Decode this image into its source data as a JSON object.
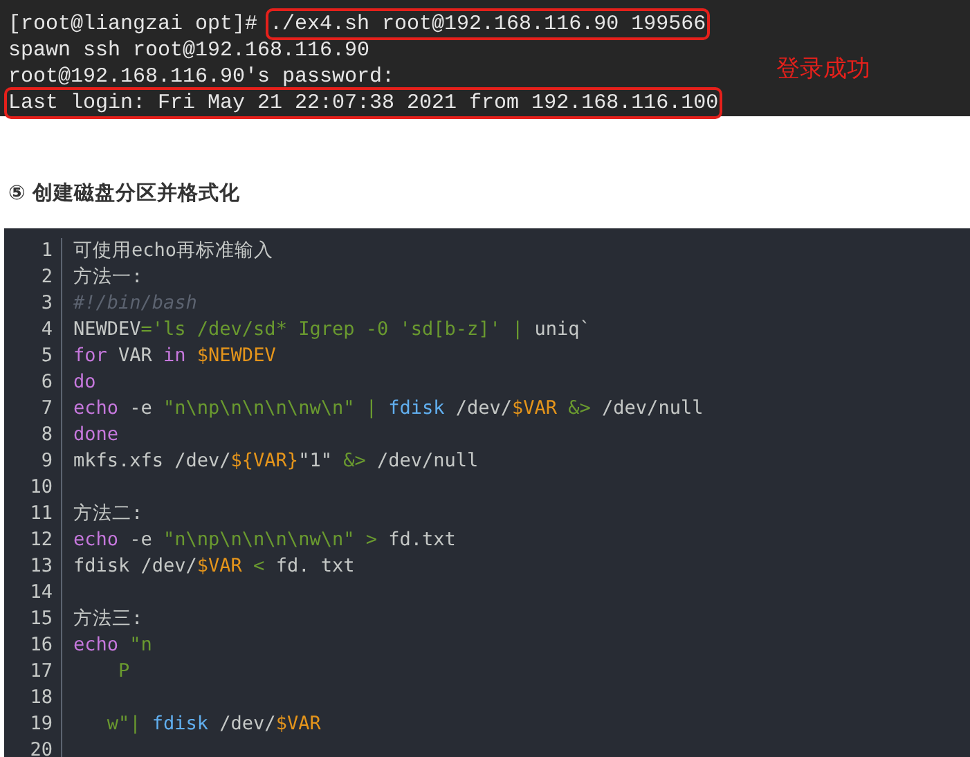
{
  "terminal": {
    "lines": [
      {
        "segments": [
          {
            "text": "[root@liangzai opt]# ",
            "boxed": false
          },
          {
            "text": "./ex4.sh root@192.168.116.90 199566",
            "boxed": true
          }
        ]
      },
      {
        "segments": [
          {
            "text": "spawn ssh root@192.168.116.90",
            "boxed": false
          }
        ]
      },
      {
        "segments": [
          {
            "text": "root@192.168.116.90's password:",
            "boxed": false
          }
        ]
      },
      {
        "segments": [
          {
            "text": "Last login: Fri May 21 22:07:38 2021 from 192.168.116.100",
            "boxed": true
          }
        ]
      }
    ],
    "annotation": "登录成功"
  },
  "heading": "⑤ 创建磁盘分区并格式化",
  "code": {
    "lines": [
      {
        "number": "1",
        "tokens": [
          {
            "kind": "plain",
            "text": "可使用echo再标准输入"
          }
        ]
      },
      {
        "number": "2",
        "tokens": [
          {
            "kind": "plain",
            "text": "方法一:"
          }
        ]
      },
      {
        "number": "3",
        "tokens": [
          {
            "kind": "comment",
            "text": "#!/bin/bash"
          }
        ]
      },
      {
        "number": "4",
        "tokens": [
          {
            "kind": "plain",
            "text": "NEWDEV"
          },
          {
            "kind": "string",
            "text": "='ls /dev/sd* Igrep -0 'sd[b-z]' | "
          },
          {
            "kind": "plain",
            "text": "uniq`"
          }
        ]
      },
      {
        "number": "5",
        "tokens": [
          {
            "kind": "keyword",
            "text": "for"
          },
          {
            "kind": "plain",
            "text": " VAR "
          },
          {
            "kind": "keyword",
            "text": "in"
          },
          {
            "kind": "variable",
            "text": " $NEWDEV"
          }
        ]
      },
      {
        "number": "6",
        "tokens": [
          {
            "kind": "keyword",
            "text": "do"
          }
        ]
      },
      {
        "number": "7",
        "tokens": [
          {
            "kind": "keyword",
            "text": "echo"
          },
          {
            "kind": "plain",
            "text": " -e "
          },
          {
            "kind": "string",
            "text": "\"n\\np\\n\\n\\n\\nw\\n\" | "
          },
          {
            "kind": "command",
            "text": "fdisk"
          },
          {
            "kind": "plain",
            "text": " /dev/"
          },
          {
            "kind": "variable",
            "text": "$VAR"
          },
          {
            "kind": "string",
            "text": " &>"
          },
          {
            "kind": "plain",
            "text": " /dev/null"
          }
        ]
      },
      {
        "number": "8",
        "tokens": [
          {
            "kind": "keyword",
            "text": "done"
          }
        ]
      },
      {
        "number": "9",
        "tokens": [
          {
            "kind": "plain",
            "text": "mkfs.xfs /dev/"
          },
          {
            "kind": "variable",
            "text": "${VAR}"
          },
          {
            "kind": "plain",
            "text": "\"1\" "
          },
          {
            "kind": "string",
            "text": "&>"
          },
          {
            "kind": "plain",
            "text": " /dev/null"
          }
        ]
      },
      {
        "number": "10"
      },
      {
        "number": "11",
        "tokens": [
          {
            "kind": "plain",
            "text": "方法二:"
          }
        ]
      },
      {
        "number": "12",
        "tokens": [
          {
            "kind": "keyword",
            "text": "echo"
          },
          {
            "kind": "plain",
            "text": " -e "
          },
          {
            "kind": "string",
            "text": "\"n\\np\\n\\n\\n\\nw\\n\" > "
          },
          {
            "kind": "plain",
            "text": "fd.txt"
          }
        ]
      },
      {
        "number": "13",
        "tokens": [
          {
            "kind": "plain",
            "text": "fdisk /dev/"
          },
          {
            "kind": "variable",
            "text": "$VAR"
          },
          {
            "kind": "string",
            "text": " < "
          },
          {
            "kind": "plain",
            "text": "fd. txt"
          }
        ]
      },
      {
        "number": "14"
      },
      {
        "number": "15",
        "tokens": [
          {
            "kind": "plain",
            "text": "方法三:"
          }
        ]
      },
      {
        "number": "16",
        "tokens": [
          {
            "kind": "keyword",
            "text": "echo"
          },
          {
            "kind": "string",
            "text": " \"n"
          }
        ]
      },
      {
        "number": "17",
        "tokens": [
          {
            "kind": "string",
            "text": "    P"
          }
        ]
      },
      {
        "number": "18"
      },
      {
        "number": "19",
        "tokens": [
          {
            "kind": "string",
            "text": "   w\"| "
          },
          {
            "kind": "command",
            "text": "fdisk"
          },
          {
            "kind": "plain",
            "text": " /dev/"
          },
          {
            "kind": "variable",
            "text": "$VAR"
          }
        ]
      },
      {
        "number": "20"
      }
    ]
  }
}
